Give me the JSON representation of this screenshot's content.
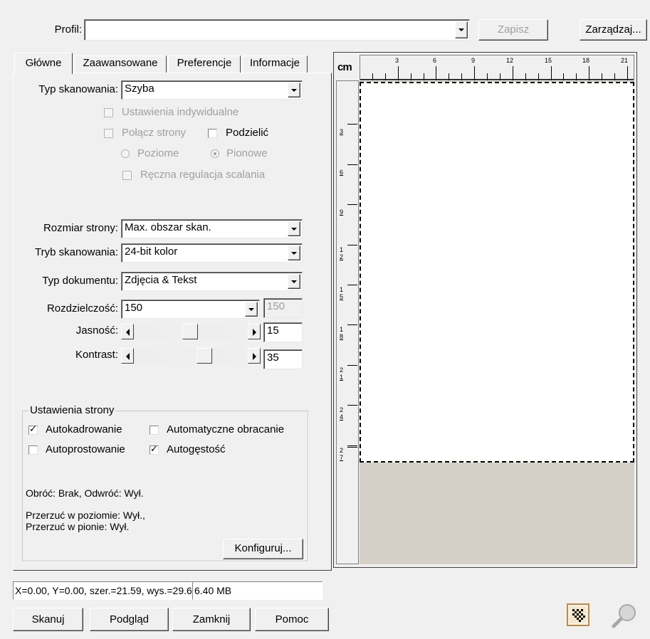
{
  "profile": {
    "label": "Profil:",
    "value": "",
    "save_button": "Zapisz",
    "manage_button": "Zarządzaj..."
  },
  "tabs": [
    "Główne",
    "Zaawansowane",
    "Preferencje",
    "Informacje"
  ],
  "main": {
    "scan_type_label": "Typ skanowania:",
    "scan_type_value": "Szyba",
    "individual_settings": "Ustawienia indywidualne",
    "merge_pages": "Połącz strony",
    "split": "Podzielić",
    "horizontal": "Poziome",
    "vertical": "Pionowe",
    "manual_merge": "Ręczna regulacja scalania",
    "page_size_label": "Rozmiar strony:",
    "page_size_value": "Max. obszar skan.",
    "scan_mode_label": "Tryb skanowania:",
    "scan_mode_value": "24-bit kolor",
    "doc_type_label": "Typ dokumentu:",
    "doc_type_value": "Zdjęcia & Tekst",
    "resolution_label": "Rozdzielczość:",
    "resolution_value": "150",
    "resolution_custom": "150",
    "brightness_label": "Jasność:",
    "brightness_value": "15",
    "contrast_label": "Kontrast:",
    "contrast_value": "35"
  },
  "page_settings": {
    "legend": "Ustawienia strony",
    "autocrop": "Autokadrowanie",
    "auto_rotate": "Automatyczne obracanie",
    "auto_deskew": "Autoprostowanie",
    "auto_density": "Autogęstość",
    "rotate_info": "Obróć: Brak, Odwróć: Wył.",
    "flip_h": "Przerzuć w poziomie: Wył.,",
    "flip_v": "Przerzuć w pionie: Wył.",
    "configure_button": "Konfiguruj..."
  },
  "ruler": {
    "unit": "cm",
    "h_labels": [
      "3",
      "6",
      "9",
      "12",
      "15",
      "18",
      "21"
    ],
    "v_labels": [
      [
        "3"
      ],
      [
        "6"
      ],
      [
        "9"
      ],
      [
        "1",
        "2"
      ],
      [
        "1",
        "5"
      ],
      [
        "1",
        "8"
      ],
      [
        "2",
        "1"
      ],
      [
        "2",
        "4"
      ],
      [
        "2",
        "7"
      ]
    ]
  },
  "status": {
    "coords": "X=0.00, Y=0.00, szer.=21.59, wys.=29.6",
    "size": "6.40 MB"
  },
  "bottom_buttons": {
    "scan": "Skanuj",
    "preview": "Podgląd",
    "close": "Zamknij",
    "help": "Pomoc"
  },
  "icons": [
    "scan-area-icon",
    "zoom-icon"
  ],
  "colors": {
    "background": "#f0f0f0",
    "preview_empty": "#d4d0c8",
    "preview_page": "#ffffff"
  }
}
